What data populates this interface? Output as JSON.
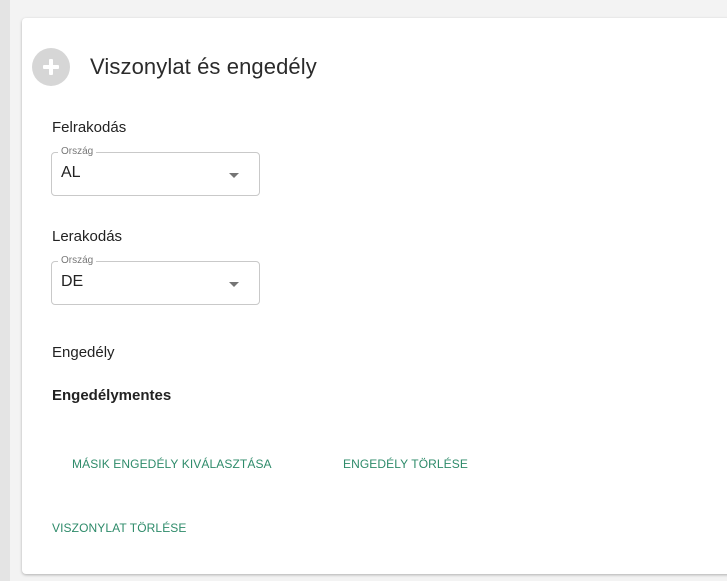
{
  "card": {
    "title": "Viszonylat és engedély",
    "icon": "plus-circle-icon"
  },
  "loading": {
    "label": "Felrakodás",
    "country_legend": "Ország",
    "country_value": "AL"
  },
  "unloading": {
    "label": "Lerakodás",
    "country_legend": "Ország",
    "country_value": "DE"
  },
  "permit": {
    "label": "Engedély",
    "value": "Engedélymentes",
    "select_other_label": "MÁSIK ENGEDÉLY KIVÁLASZTÁSA",
    "delete_label": "ENGEDÉLY TÖRLÉSE"
  },
  "relation": {
    "delete_label": "VISZONYLAT TÖRLÉSE"
  },
  "colors": {
    "accent": "#2e8b6a",
    "icon_bg": "#d6d6d6"
  }
}
